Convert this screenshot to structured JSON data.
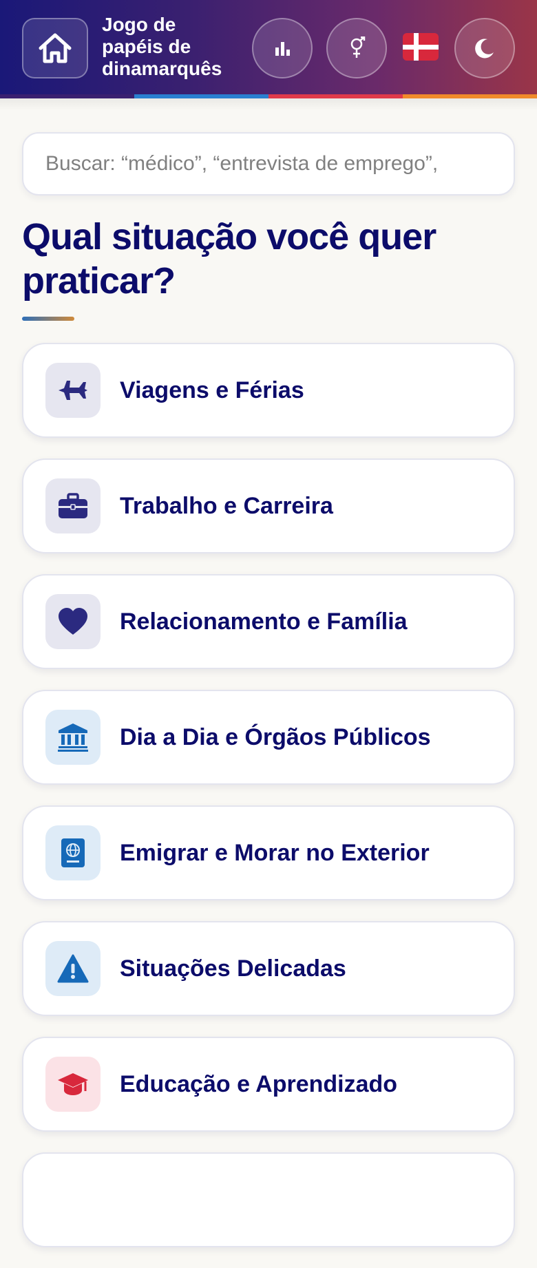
{
  "header": {
    "title": "Jogo de\npapéis de\ndinamarquês",
    "stripe_colors": [
      "#3a2070",
      "#2a7fd0",
      "#e03a4a",
      "#f08a2a"
    ]
  },
  "toolbar": {
    "stats_icon": "bar-chart-icon",
    "gender_icon": "gender-icon",
    "language_flag": "denmark-flag",
    "theme_icon": "moon-icon"
  },
  "search": {
    "placeholder": "Buscar: “médico”, “entrevista de emprego”,"
  },
  "main": {
    "heading": "Qual situação você quer praticar?"
  },
  "categories": [
    {
      "label": "Viagens e Férias",
      "icon": "airplane-icon",
      "icon_bg": "#e6e6f0",
      "icon_color": "#2b2a80"
    },
    {
      "label": "Trabalho e Carreira",
      "icon": "briefcase-icon",
      "icon_bg": "#e6e6f0",
      "icon_color": "#2b2a80"
    },
    {
      "label": "Relacionamento e Família",
      "icon": "heart-icon",
      "icon_bg": "#e6e6f0",
      "icon_color": "#2b2a80"
    },
    {
      "label": "Dia a Dia e Órgãos Públicos",
      "icon": "institution-icon",
      "icon_bg": "#deebf7",
      "icon_color": "#1669b8"
    },
    {
      "label": "Emigrar e Morar no Exterior",
      "icon": "passport-icon",
      "icon_bg": "#deebf7",
      "icon_color": "#1669b8"
    },
    {
      "label": "Situações Delicadas",
      "icon": "warning-icon",
      "icon_bg": "#deebf7",
      "icon_color": "#1669b8"
    },
    {
      "label": "Educação e Aprendizado",
      "icon": "graduation-cap-icon",
      "icon_bg": "#fbe2e6",
      "icon_color": "#d8283c"
    }
  ]
}
